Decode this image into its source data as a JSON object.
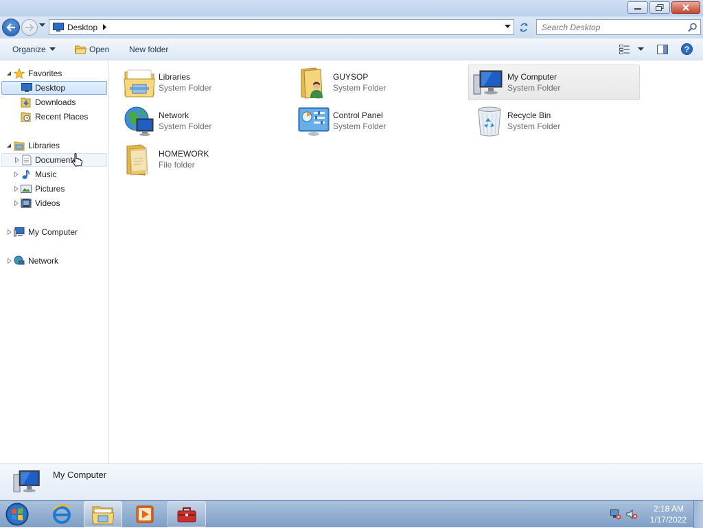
{
  "window": {
    "address": {
      "location": "Desktop"
    },
    "search": {
      "placeholder": "Search Desktop"
    },
    "toolbar": {
      "organize_label": "Organize",
      "open_label": "Open",
      "new_folder_label": "New folder"
    }
  },
  "navpane": {
    "favorites": {
      "label": "Favorites",
      "items": [
        "Desktop",
        "Downloads",
        "Recent Places"
      ]
    },
    "libraries": {
      "label": "Libraries",
      "items": [
        "Documents",
        "Music",
        "Pictures",
        "Videos"
      ]
    },
    "my_computer": "My Computer",
    "network": "Network"
  },
  "content": {
    "items": [
      {
        "name": "Libraries",
        "type": "System Folder",
        "icon": "libraries-folder-icon"
      },
      {
        "name": "GUYSOP",
        "type": "System Folder",
        "icon": "user-folder-icon"
      },
      {
        "name": "My Computer",
        "type": "System Folder",
        "icon": "computer-icon",
        "selected": true
      },
      {
        "name": "Network",
        "type": "System Folder",
        "icon": "network-globe-icon"
      },
      {
        "name": "Control Panel",
        "type": "System Folder",
        "icon": "control-panel-icon"
      },
      {
        "name": "Recycle Bin",
        "type": "System Folder",
        "icon": "recycle-bin-icon"
      },
      {
        "name": "HOMEWORK",
        "type": "File folder",
        "icon": "folder-icon"
      }
    ]
  },
  "details": {
    "name": "My Computer"
  },
  "taskbar": {
    "apps": [
      "internet-explorer",
      "windows-explorer",
      "media-player",
      "toolbox"
    ],
    "clock": {
      "time": "2:18 AM",
      "date": "1/17/2022"
    }
  },
  "colors": {
    "accent": "#1f5fb3",
    "selection": "#cfe4fb",
    "taskbar": "#8fadd0"
  }
}
